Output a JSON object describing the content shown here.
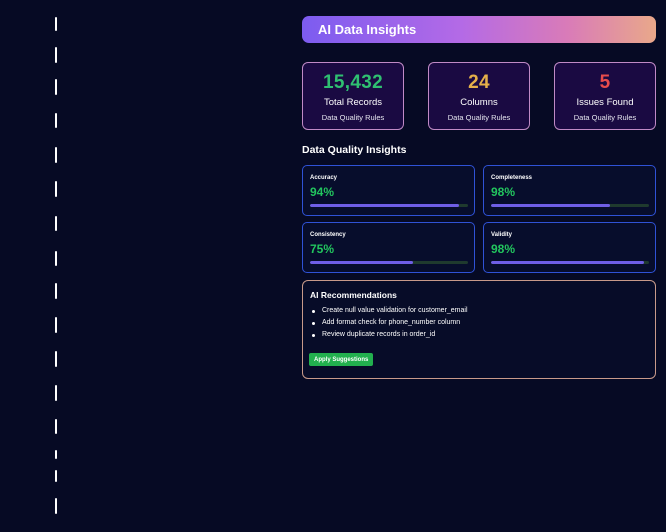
{
  "banner": {
    "title": "AI Data Insights"
  },
  "stats": [
    {
      "value": "15,432",
      "label": "Total Records",
      "sub": "Data Quality Rules",
      "color": "#2fbf71"
    },
    {
      "value": "24",
      "label": "Columns",
      "sub": "Data Quality Rules",
      "color": "#e5b04a"
    },
    {
      "value": "5",
      "label": "Issues Found",
      "sub": "Data Quality Rules",
      "color": "#e74c4c"
    }
  ],
  "insights": {
    "title": "Data Quality Insights",
    "metrics": [
      {
        "name": "Accuracy",
        "value": "94%",
        "fraction": 0.94
      },
      {
        "name": "Completeness",
        "value": "98%",
        "fraction": 0.75
      },
      {
        "name": "Consistency",
        "value": "75%",
        "fraction": 0.65
      },
      {
        "name": "Validity",
        "value": "98%",
        "fraction": 0.97
      }
    ]
  },
  "recommendations": {
    "title": "AI Recommendations",
    "items": [
      "Create null value validation for customer_email",
      "Add format check for phone_number column",
      "Review duplicate records in order_id"
    ],
    "button_label": "Apply Suggestions"
  }
}
